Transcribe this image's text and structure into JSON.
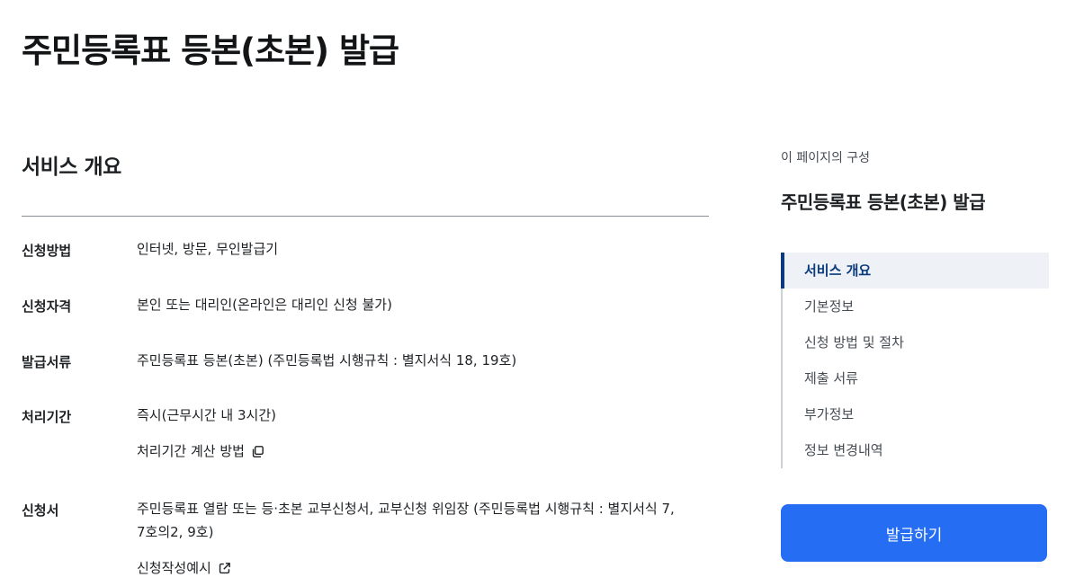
{
  "page": {
    "title": "주민등록표 등본(초본) 발급"
  },
  "overview": {
    "title": "서비스 개요",
    "rows": [
      {
        "label": "신청방법",
        "value": "인터넷, 방문, 무인발급기"
      },
      {
        "label": "신청자격",
        "value": "본인 또는 대리인(온라인은 대리인 신청 불가)"
      },
      {
        "label": "발급서류",
        "value": "주민등록표 등본(초본) (주민등록법 시행규칙 : 별지서식 18, 19호)"
      },
      {
        "label": "처리기간",
        "value": "즉시(근무시간 내 3시간)",
        "link": "처리기간 계산 방법",
        "link_icon": "copy-icon"
      },
      {
        "label": "신청서",
        "value_line1": "주민등록표 열람 또는 등·초본 교부신청서, 교부신청 위임장 (주민등록법 시행규칙 : 별지서식 7,",
        "value_line2": "7호의2, 9호)",
        "link": "신청작성예시",
        "link_icon": "external-link-icon"
      }
    ]
  },
  "toc": {
    "caption": "이 페이지의 구성",
    "title": "주민등록표 등본(초본) 발급",
    "items": [
      "서비스 개요",
      "기본정보",
      "신청 방법 및 절차",
      "제출 서류",
      "부가정보",
      "정보 변경내역"
    ],
    "active_index": 0
  },
  "actions": {
    "issue_button": "발급하기"
  },
  "colors": {
    "accent": "#256ef4",
    "nav_active": "#0b3b7c",
    "nav_active_bg": "#eef2f7"
  }
}
